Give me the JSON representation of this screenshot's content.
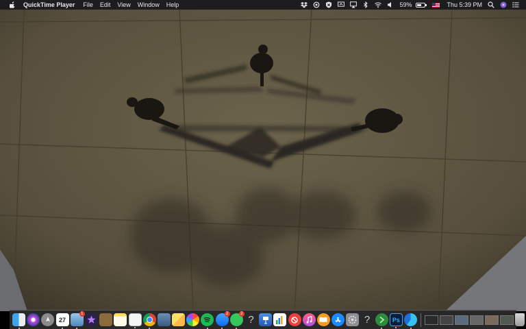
{
  "menubar": {
    "apple_icon": "apple-icon",
    "app_name": "QuickTime Player",
    "menus": [
      "File",
      "Edit",
      "View",
      "Window",
      "Help"
    ],
    "status": {
      "battery_percent": "59%",
      "battery_level": 0.59,
      "clock": "Thu 5:39 PM"
    }
  },
  "video": {
    "description_colors": {
      "ground": "#5d5541",
      "shadow": "#2b2620"
    }
  },
  "dock": {
    "calendar_day": "27",
    "badges": {
      "preview": "1",
      "messenger": "2",
      "messages": "2"
    },
    "items": [
      "finder-icon",
      "siri-icon",
      "launchpad-icon",
      "calendar-icon",
      "preview-icon",
      "imovie-icon",
      "archive-utility-icon",
      "notes-icon",
      "textedit-icon",
      "chrome-icon",
      "image-capture-icon",
      "sticky-notes-icon",
      "photos-icon",
      "spotify-icon",
      "messenger-icon",
      "messages-icon",
      "help-icon",
      "keynote-icon",
      "numbers-icon",
      "news-icon",
      "music-icon",
      "books-icon",
      "app-store-icon",
      "system-preferences-icon",
      "help-icon",
      "android-file-transfer-icon",
      "photoshop-icon",
      "edge-icon"
    ],
    "photoshop_label": "Ps"
  }
}
